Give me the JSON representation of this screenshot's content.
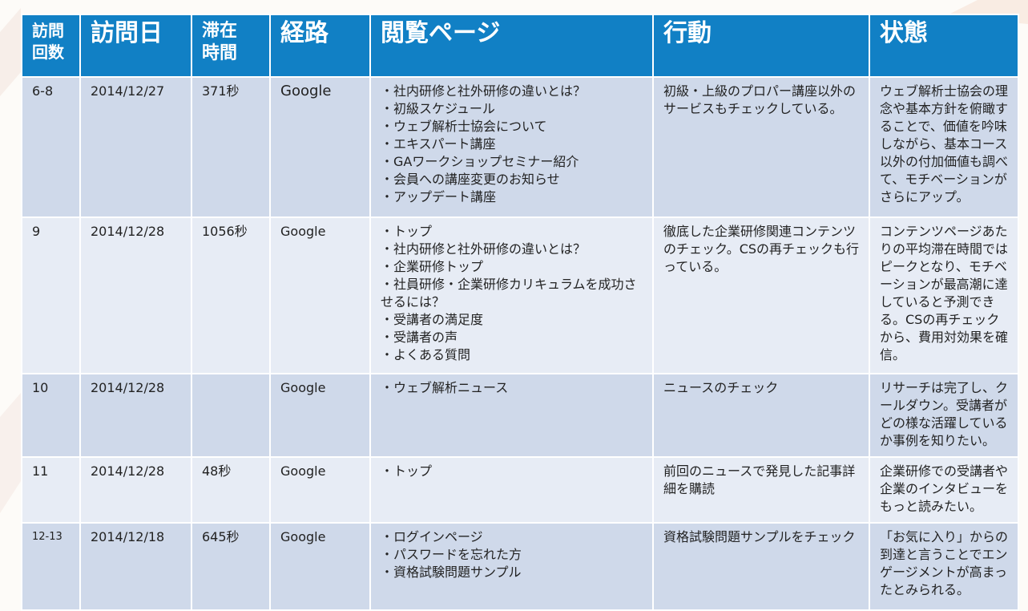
{
  "columns": {
    "visits": "訪問\n回数",
    "visit_date": "訪問日",
    "stay_time": "滞在\n時間",
    "route": "経路",
    "pages": "閲覧ページ",
    "action": "行動",
    "state": "状態"
  },
  "rows": [
    {
      "visits": "6-8",
      "date": "2014/12/27",
      "stay": "371秒",
      "route": "Google",
      "pages": [
        "・社内研修と社外研修の違いとは？",
        "・初級スケジュール",
        "・ウェブ解析士協会について",
        "・エキスパート講座",
        "・GAワークショップセミナー紹介",
        "・会員への講座変更のお知らせ",
        "・アップデート講座"
      ],
      "action": "初級・上級のプロパー講座以外のサービスもチェックしている。",
      "state": "ウェブ解析士協会の理念や基本方針を俯瞰することで、価値を吟味しながら、基本コース以外の付加価値も調べて、モチベーションがさらにアップ。"
    },
    {
      "visits": "9",
      "date": "2014/12/28",
      "stay": "1056秒",
      "route": "Google",
      "pages": [
        "・トップ",
        "・社内研修と社外研修の違いとは？",
        "・企業研修トップ",
        "・社員研修・企業研修カリキュラムを成功させるには？",
        "・受講者の満足度",
        "・受講者の声",
        "・よくある質問"
      ],
      "action": "徹底した企業研修関連コンテンツのチェック。CSの再チェックも行っている。",
      "state": "コンテンツページあたりの平均滞在時間ではピークとなり、モチベーションが最高潮に達していると予測できる。CSの再チェックから、費用対効果を確信。"
    },
    {
      "visits": "10",
      "date": "2014/12/28",
      "stay": "",
      "route": "Google",
      "pages": [
        "・ウェブ解析ニュース"
      ],
      "action": "ニュースのチェック",
      "state": "リサーチは完了し、クールダウン。受講者がどの様な活躍しているか事例を知りたい。"
    },
    {
      "visits": "11",
      "date": "2014/12/28",
      "stay": "48秒",
      "route": "Google",
      "pages": [
        "・トップ"
      ],
      "action": "前回のニュースで発見した記事詳細を購読",
      "state": "企業研修での受講者や企業のインタビューをもっと読みたい。"
    },
    {
      "visits": "12-13",
      "date": "2014/12/18",
      "stay": "645秒",
      "route": "Google",
      "pages": [
        "・ログインページ",
        "・パスワードを忘れた方",
        "・資格試験問題サンプル"
      ],
      "action": "資格試験問題サンプルをチェック",
      "state": "「お気に入り」からの到達と言うことでエンゲージメントが高まったとみられる。"
    }
  ],
  "colors": {
    "header_bg": "#1180c5",
    "row_dark": "#cfd9ea",
    "row_light": "#e7ecf5"
  }
}
